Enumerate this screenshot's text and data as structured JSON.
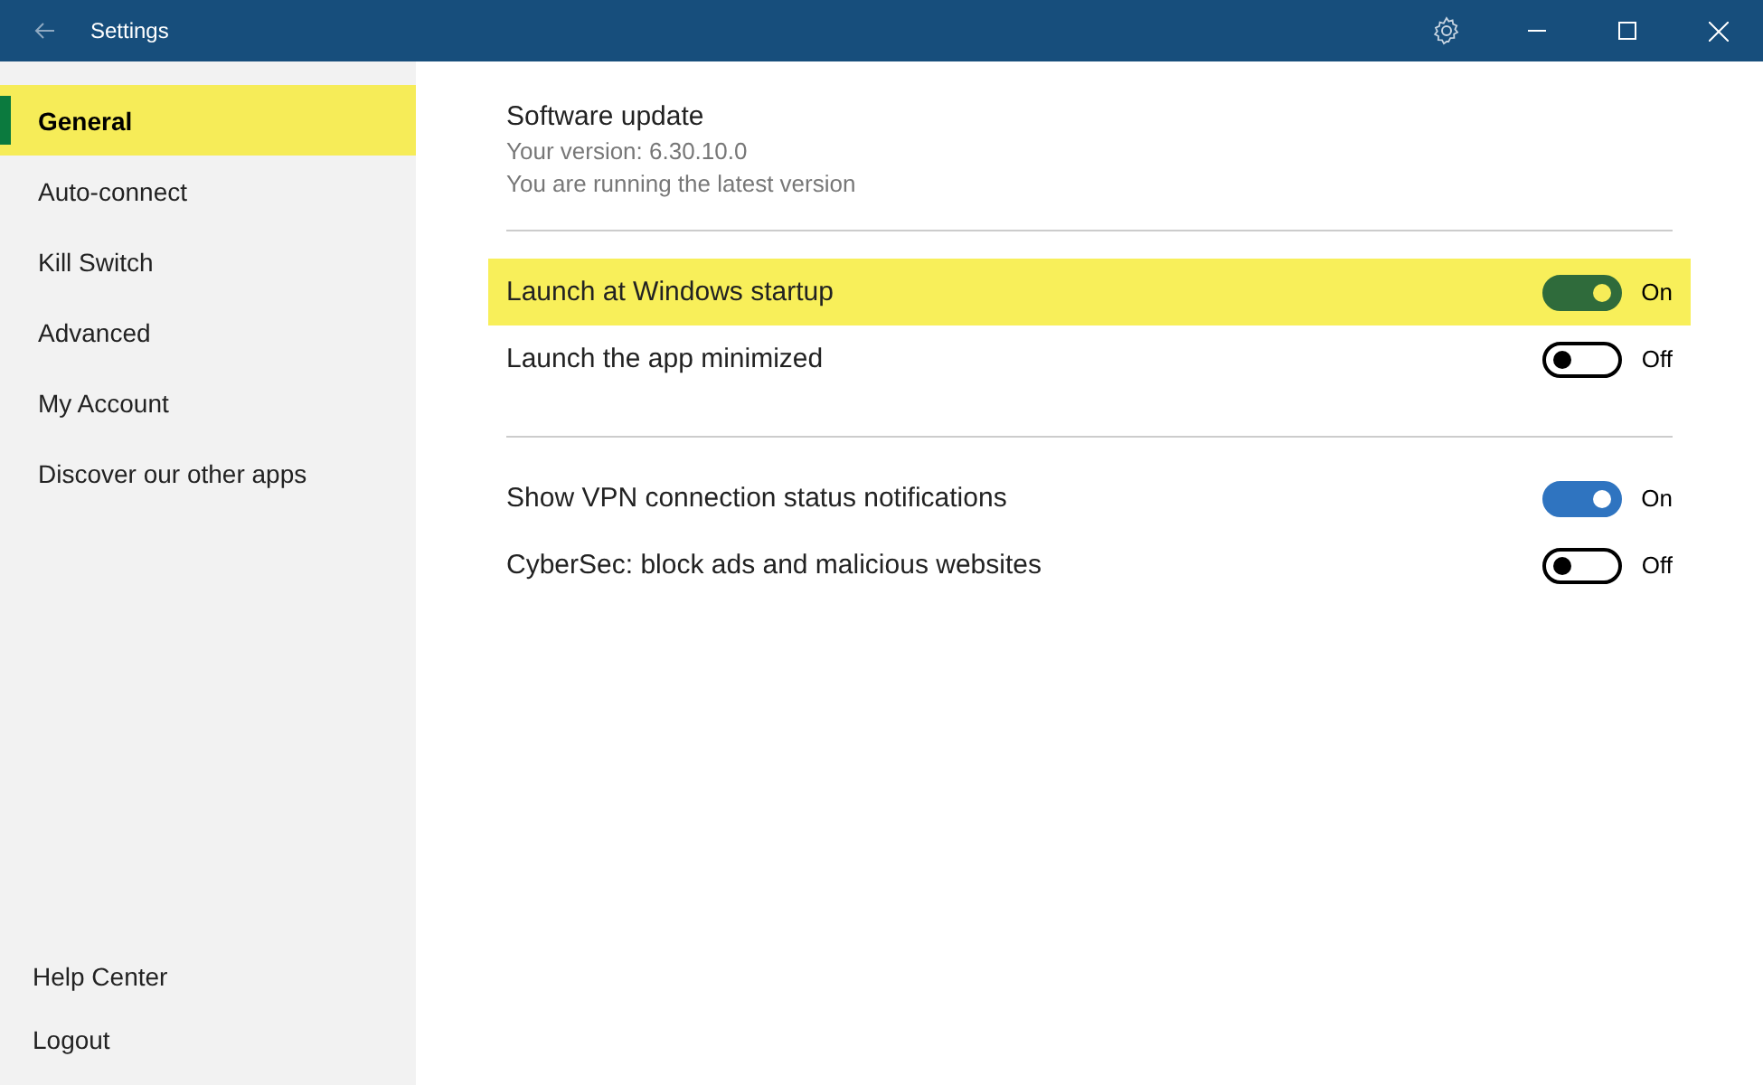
{
  "window": {
    "title": "Settings"
  },
  "sidebar": {
    "items": [
      {
        "label": "General",
        "selected": true
      },
      {
        "label": "Auto-connect",
        "selected": false
      },
      {
        "label": "Kill Switch",
        "selected": false
      },
      {
        "label": "Advanced",
        "selected": false
      },
      {
        "label": "My Account",
        "selected": false
      },
      {
        "label": "Discover our other apps",
        "selected": false
      }
    ],
    "footer": [
      "Help Center",
      "Logout"
    ]
  },
  "software_update": {
    "title": "Software update",
    "lines": [
      "Your version: 6.30.10.0",
      "You are running the latest version"
    ]
  },
  "groups": [
    [
      {
        "label": "Launch at Windows startup",
        "on": true,
        "highlighted": true,
        "state_text": "On"
      },
      {
        "label": "Launch the app minimized",
        "on": false,
        "highlighted": false,
        "state_text": "Off"
      }
    ],
    [
      {
        "label": "Show VPN connection status notifications",
        "on": true,
        "highlighted": false,
        "state_text": "On"
      },
      {
        "label": "CyberSec: block ads and malicious websites",
        "on": false,
        "highlighted": false,
        "state_text": "Off"
      }
    ]
  ]
}
